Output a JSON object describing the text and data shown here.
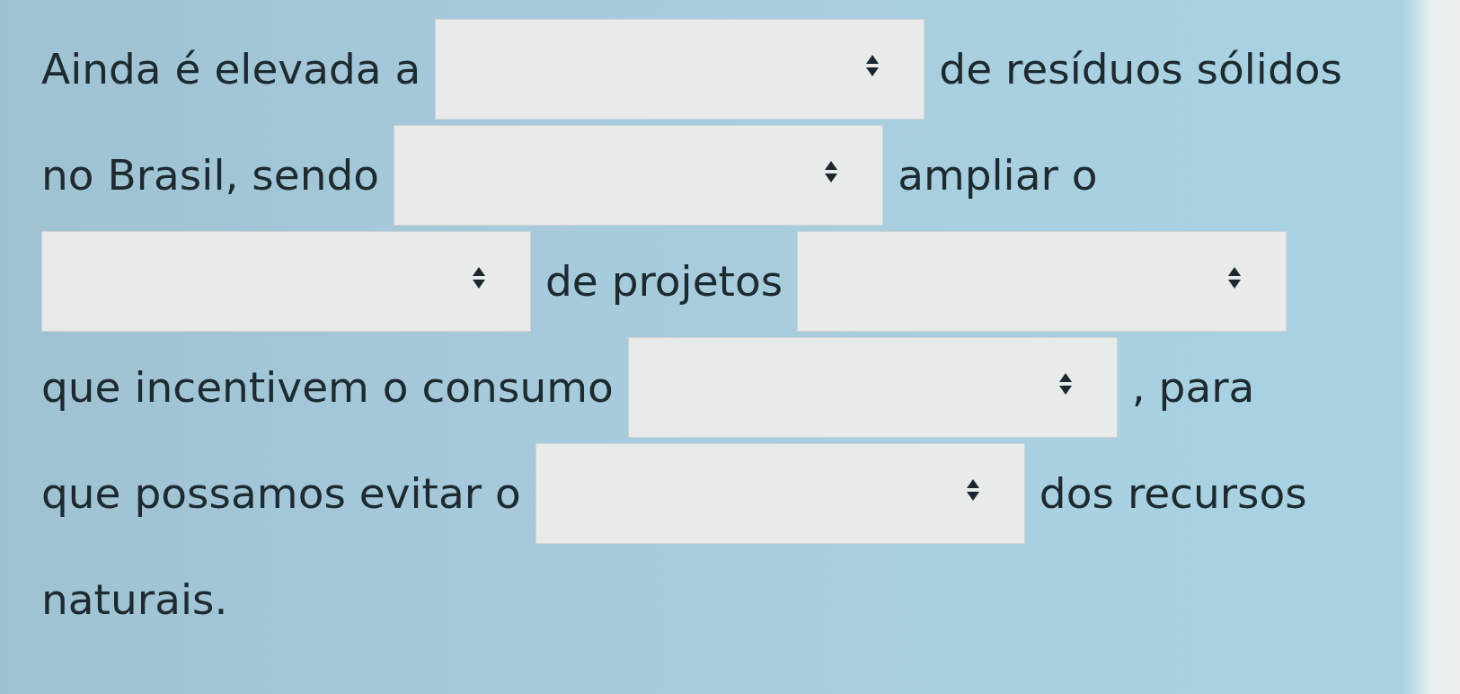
{
  "lines": [
    {
      "parts": [
        {
          "kind": "text",
          "text": "Ainda é elevada a"
        },
        {
          "kind": "select"
        },
        {
          "kind": "text",
          "text": "de resíduos sólidos"
        }
      ]
    },
    {
      "parts": [
        {
          "kind": "text",
          "text": "no Brasil, sendo"
        },
        {
          "kind": "select"
        },
        {
          "kind": "text",
          "text": "ampliar o"
        }
      ]
    },
    {
      "parts": [
        {
          "kind": "select"
        },
        {
          "kind": "text",
          "text": "de projetos"
        },
        {
          "kind": "select"
        }
      ]
    },
    {
      "parts": [
        {
          "kind": "text",
          "text": "que incentivem o consumo"
        },
        {
          "kind": "select"
        },
        {
          "kind": "text",
          "text": ", para"
        }
      ]
    },
    {
      "parts": [
        {
          "kind": "text",
          "text": "que possamos evitar o"
        },
        {
          "kind": "select"
        },
        {
          "kind": "text",
          "text": "dos recursos"
        }
      ]
    },
    {
      "parts": [
        {
          "kind": "text",
          "text": "naturais."
        }
      ]
    }
  ]
}
